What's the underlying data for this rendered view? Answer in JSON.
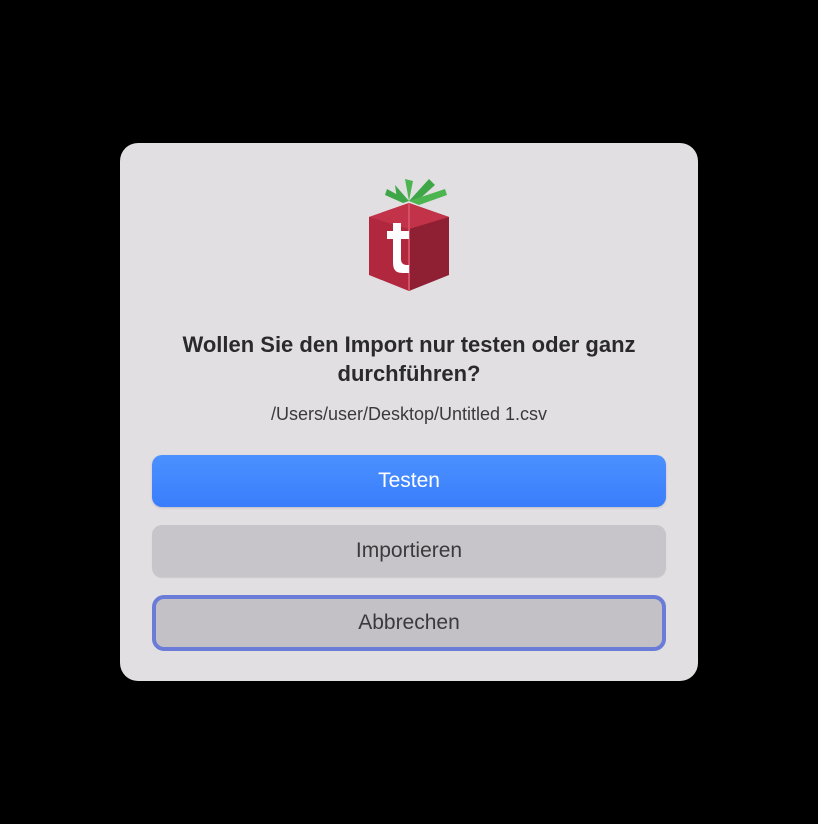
{
  "dialog": {
    "title": "Wollen Sie den Import nur testen oder ganz durchführen?",
    "message": "/Users/user/Desktop/Untitled 1.csv",
    "buttons": {
      "primary": "Testen",
      "secondary": "Importieren",
      "cancel": "Abbrechen"
    },
    "icon": "tomato-app-icon"
  }
}
